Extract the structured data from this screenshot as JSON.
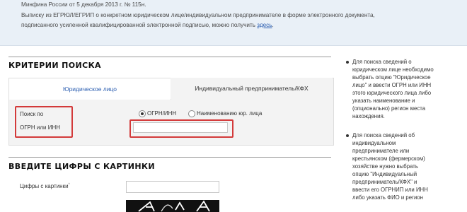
{
  "info_banner": {
    "line1": "Минфина России от 5 декабря 2013 г. № 115н.",
    "line2": "Выписку из ЕГРЮЛ/ЕГРИП о конкретном юридическом лице/индивидуальном предпринимателе в форме электронного документа,",
    "line3_prefix": "подписанного усиленной квалифицированной электронной подписью, можно получить ",
    "line3_link": "здесь",
    "line3_suffix": "."
  },
  "search_criteria": {
    "title": "КРИТЕРИИ ПОИСКА",
    "tabs": [
      {
        "label": "Юридическое лицо",
        "active": true
      },
      {
        "label": "Индивидуальный предприниматель/КФХ",
        "active": false
      }
    ],
    "search_by_label_line1": "Поиск по",
    "search_by_label_line2": "ОГРН или ИНН",
    "radio_options": [
      {
        "label": "ОГРН/ИНН",
        "checked": true
      },
      {
        "label": "Наименованию юр. лица",
        "checked": false
      }
    ],
    "query_value": ""
  },
  "captcha_section": {
    "title": "ВВЕДИТЕ ЦИФРЫ С КАРТИНКИ",
    "field_label": "Цифры с картинки",
    "required_mark": "*",
    "input_value": ""
  },
  "sidebar_help": {
    "item1": [
      "Для поиска сведений о",
      "юридическом лице необходимо",
      "выбрать опцию \"Юридическое",
      "лицо\" и ввести ОГРН или ИНН",
      "этого юридического лица либо",
      "указать наименование и",
      "(опционально) регион места",
      "нахождения."
    ],
    "item2": [
      "Для поиска сведений об",
      "индивидуальном",
      "предпринимателе или",
      "крестьянском (фермерском)",
      "хозяйстве нужно выбрать",
      "опцию \"Индивидуальный",
      "предприниматель/КФХ\" и",
      "ввести его ОГРНИП или ИНН",
      "либо указать ФИО и регион"
    ]
  },
  "colors": {
    "banner_bg": "#e9f0f7",
    "link": "#2a5db0",
    "highlight": "#d33a3a",
    "panel_bg": "#f3f3f3"
  }
}
